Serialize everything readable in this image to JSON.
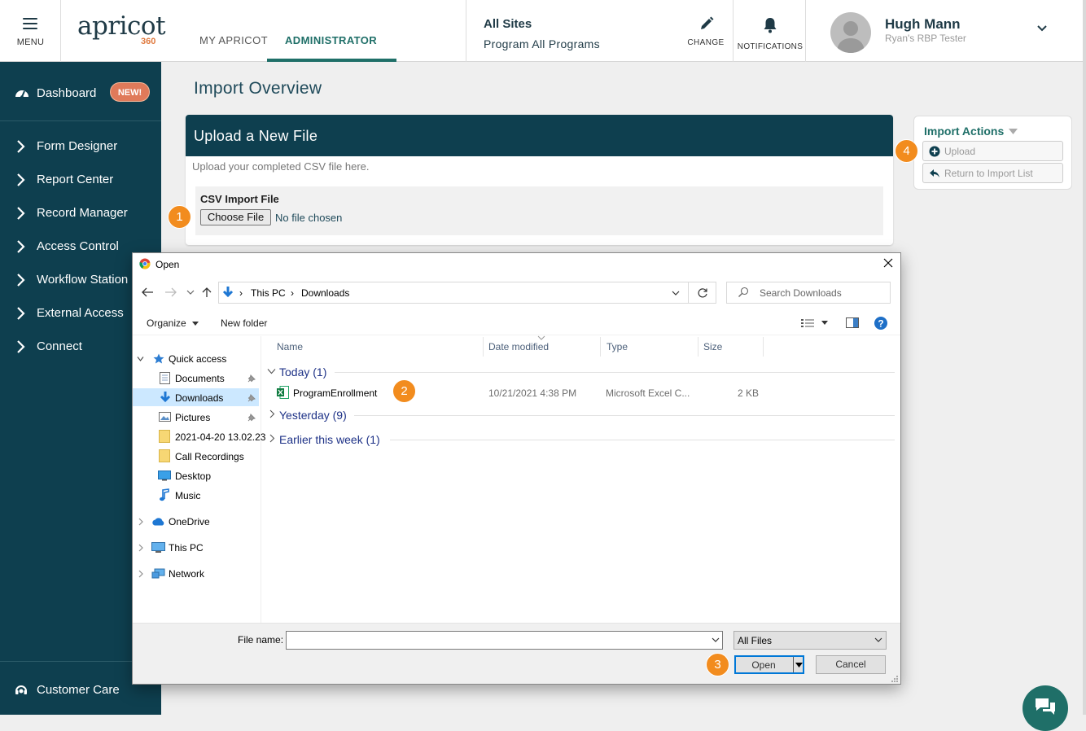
{
  "topbar": {
    "menu_label": "MENU",
    "logo_text": "apricot",
    "logo_sub": "360",
    "tabs": [
      {
        "label": "MY APRICOT"
      },
      {
        "label": "ADMINISTRATOR"
      }
    ],
    "site": "All Sites",
    "program": "Program All Programs",
    "change_label": "CHANGE",
    "notifications_label": "NOTIFICATIONS",
    "user_name": "Hugh Mann",
    "user_role": "Ryan's RBP Tester"
  },
  "sidebar": {
    "dashboard": "Dashboard",
    "new_badge": "NEW!",
    "items": [
      {
        "label": "Form Designer"
      },
      {
        "label": "Report Center"
      },
      {
        "label": "Record Manager"
      },
      {
        "label": "Access Control"
      },
      {
        "label": "Workflow Station"
      },
      {
        "label": "External Access"
      },
      {
        "label": "Connect"
      }
    ],
    "customer_care": "Customer Care"
  },
  "main": {
    "page_title": "Import Overview",
    "upload": {
      "title": "Upload a New File",
      "hint": "Upload your completed CSV file here.",
      "field_label": "CSV Import File",
      "choose_button": "Choose File",
      "no_file": "No file chosen"
    },
    "actions": {
      "title": "Import Actions",
      "upload": "Upload",
      "return": "Return to Import List"
    },
    "steps": [
      "1",
      "2",
      "3",
      "4"
    ]
  },
  "dialog": {
    "title": "Open",
    "breadcrumb": [
      "This PC",
      "Downloads"
    ],
    "search_placeholder": "Search Downloads",
    "organize": "Organize",
    "new_folder": "New folder",
    "nav": {
      "quick_access": "Quick access",
      "quick_items": [
        "Documents",
        "Downloads",
        "Pictures",
        "2021-04-20 13.02.23",
        "Call Recordings",
        "Desktop",
        "Music"
      ],
      "onedrive": "OneDrive",
      "this_pc": "This PC",
      "network": "Network"
    },
    "columns": {
      "name": "Name",
      "date": "Date modified",
      "type": "Type",
      "size": "Size"
    },
    "groups": {
      "today": "Today (1)",
      "yesterday": "Yesterday (9)",
      "earlier": "Earlier this week (1)"
    },
    "file": {
      "name": "ProgramEnrollment",
      "date": "10/21/2021 4:38 PM",
      "type": "Microsoft Excel C...",
      "size": "2 KB"
    },
    "footer": {
      "file_name_label": "File name:",
      "file_name_value": "",
      "filter": "All Files",
      "open": "Open",
      "cancel": "Cancel"
    }
  },
  "colors": {
    "sidebar": "#0e3f4f",
    "accent": "#1f6f68",
    "step": "#f28c1e",
    "badge": "#e07a5a"
  }
}
